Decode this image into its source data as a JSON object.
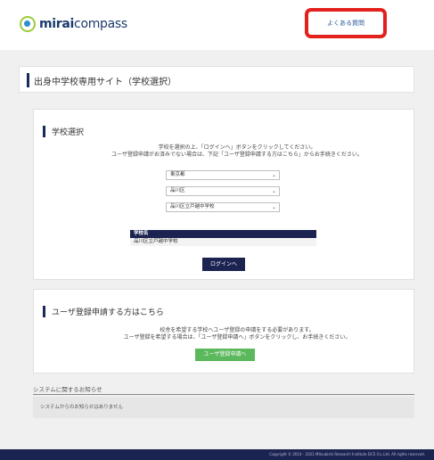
{
  "header": {
    "logo_bold": "mirai",
    "logo_rest": "compass",
    "faq_label": "よくある質問"
  },
  "page_title": "出身中学校専用サイト（学校選択）",
  "school_select": {
    "heading": "学校選択",
    "instruction_line1": "学校を選択の上、「ログインへ」ボタンをクリックしてください。",
    "instruction_line2": "ユーザ登録申請がお済みでない場合は、下記「ユーザ登録申請する方はこちら」からお手続きください。",
    "prefecture": "東京都",
    "city": "品川区",
    "school": "品川区立戸越中学校",
    "result_header": "学校名",
    "result_value": "品川区立戸越中学校",
    "login_button": "ログインへ"
  },
  "user_registration": {
    "heading": "ユーザ登録申請する方はこちら",
    "text_line1": "校舎を希望する学校へユーザ登録の申請をする必要があります。",
    "text_line2": "ユーザ登録を希望する場合は、「ユーザ登録申請へ」ボタンをクリックし、お手続きください。",
    "button": "ユーザ登録申請へ"
  },
  "notice": {
    "title": "システムに関するお知らせ",
    "message": "システムからのお知らせはありません"
  },
  "footer": {
    "copyright": "Copyright © 2014 - 2021 Mitsubishi Research Institute DCS Co.,Ltd. All rights reserved."
  }
}
